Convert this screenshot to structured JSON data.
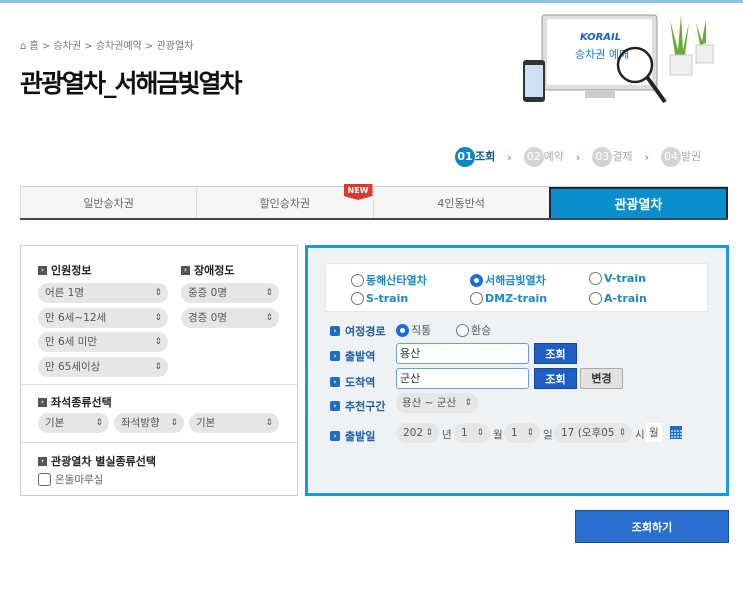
{
  "breadcrumb": {
    "items": [
      "홈",
      "승차권",
      "승차권예약",
      "관광열차"
    ],
    "sep": " > "
  },
  "page_title": "관광열차_서해금빛열차",
  "banner": {
    "logo": "KORAIL",
    "caption": "승차권 예매"
  },
  "steps": [
    {
      "num": "01",
      "label": "조회",
      "active": true
    },
    {
      "num": "02",
      "label": "예약"
    },
    {
      "num": "03",
      "label": "결제"
    },
    {
      "num": "04",
      "label": "발권"
    }
  ],
  "tabs": [
    {
      "label": "일반승차권"
    },
    {
      "label": "할인승차권",
      "badge": "NEW"
    },
    {
      "label": "4인동반석"
    },
    {
      "label": "관광열차",
      "active": true
    }
  ],
  "left": {
    "passenger_label": "인원정보",
    "disability_label": "장애정도",
    "passengers": [
      "어른 1명",
      "만 6세~12세",
      "만 6세 미만",
      "만 65세이상"
    ],
    "disability": [
      "중증 0명",
      "경증 0명"
    ],
    "seat_label": "좌석종류선택",
    "seat_selects": [
      "기본",
      "좌석방향",
      "기본"
    ],
    "room_label": "관광열차 별실종류선택",
    "room_option": "온돌마루실",
    "room_checked": false
  },
  "right": {
    "trains": [
      {
        "label": "동해산타열차"
      },
      {
        "label": "서해금빛열차",
        "selected": true
      },
      {
        "label": "V-train"
      },
      {
        "label": "S-train"
      },
      {
        "label": "DMZ-train"
      },
      {
        "label": "A-train"
      }
    ],
    "route_label": "여정경로",
    "route_options": [
      {
        "label": "직통",
        "selected": true
      },
      {
        "label": "환승"
      }
    ],
    "dep_label": "출발역",
    "dep_value": "용산",
    "arr_label": "도착역",
    "arr_value": "군산",
    "lookup": "조회",
    "swap": "변경",
    "rec_label": "추천구간",
    "rec_value": "용산 ~ 군산",
    "date_label": "출발일",
    "year": "202",
    "year_unit": "년",
    "month": "1",
    "month_unit": "월",
    "day": "1",
    "day_unit": "일",
    "hour": "17 (오후05",
    "hour_unit": "시",
    "weekday": "월"
  },
  "search_button": "조회하기",
  "colors": {
    "accent": "#0b8fcc",
    "button": "#2a6fcf",
    "panel_border": "#1a9ad6"
  }
}
